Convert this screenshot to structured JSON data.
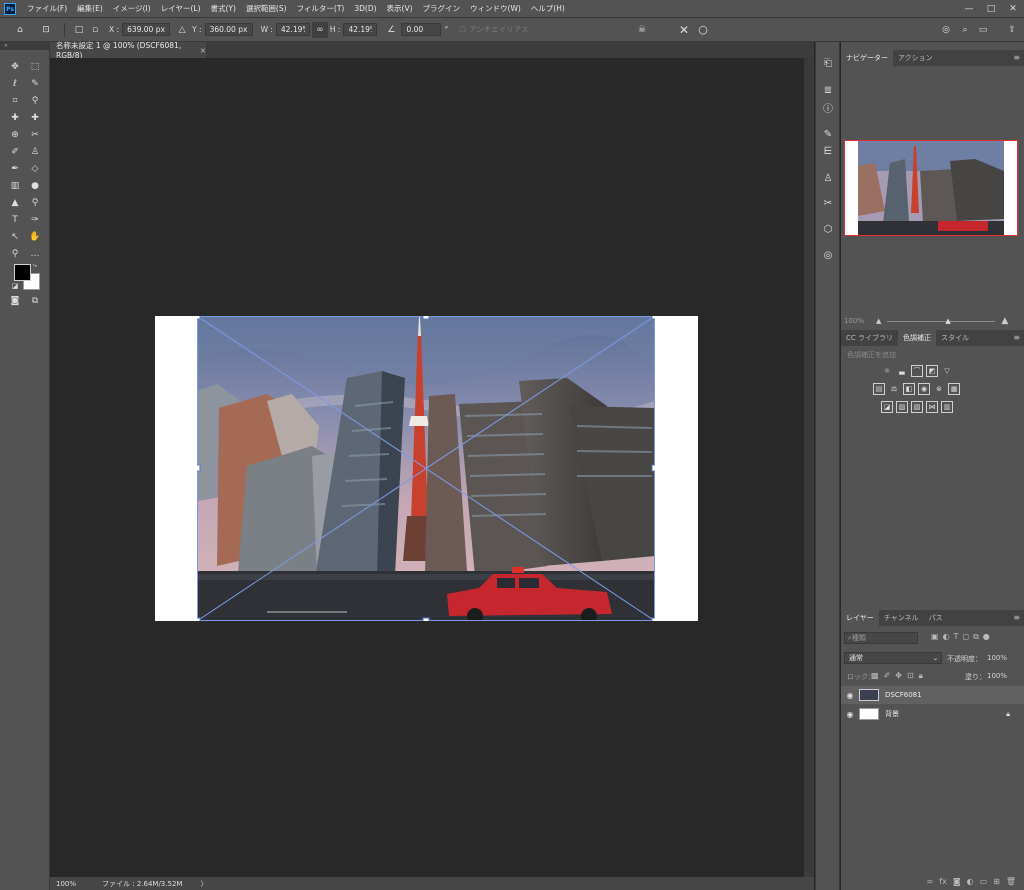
{
  "menubar": {
    "logo": "Ps",
    "items": [
      "ファイル(F)",
      "編集(E)",
      "イメージ(I)",
      "レイヤー(L)",
      "書式(Y)",
      "選択範囲(S)",
      "フィルター(T)",
      "3D(D)",
      "表示(V)",
      "プラグイン",
      "ウィンドウ(W)",
      "ヘルプ(H)"
    ],
    "window_controls": [
      "—",
      "□",
      "✕"
    ]
  },
  "options": {
    "x_label": "X :",
    "x_value": "639.00 px",
    "y_label": "Y :",
    "y_value": "360.00 px",
    "w_label": "W :",
    "w_value": "42.19%",
    "h_label": "H :",
    "h_value": "42.19%",
    "angle_value": "0.00",
    "angle_unit": "°",
    "antialias_label": "アンチエイリアス"
  },
  "document": {
    "tab_title": "名称未設定 1 @ 100% (DSCF6081, RGB/8)",
    "tab_close": "×"
  },
  "status": {
    "zoom": "100%",
    "file_info": "ファイル : 2.64M/3.52M",
    "arrow": "〉"
  },
  "panels": {
    "navigator_tabs": [
      "ナビゲーター",
      "アクション"
    ],
    "nav_zoom": "100%",
    "adjust_tabs": [
      "CC ライブラリ",
      "色調補正",
      "スタイル"
    ],
    "adjust_hint": "色調補正を追加",
    "layers_tabs": [
      "レイヤー",
      "チャンネル",
      "パス"
    ],
    "layer_search": "種類",
    "blend_mode": "通常",
    "opacity_label": "不透明度：",
    "opacity_value": "100%",
    "lock_label": "ロック：",
    "fill_label": "塗り：",
    "fill_value": "100%",
    "layers": [
      {
        "name": "DSCF6081"
      },
      {
        "name": "背景"
      }
    ]
  },
  "colors": {
    "accent_red": "#e03030",
    "ui_dark": "#535353",
    "canvas_bg": "#282828"
  }
}
